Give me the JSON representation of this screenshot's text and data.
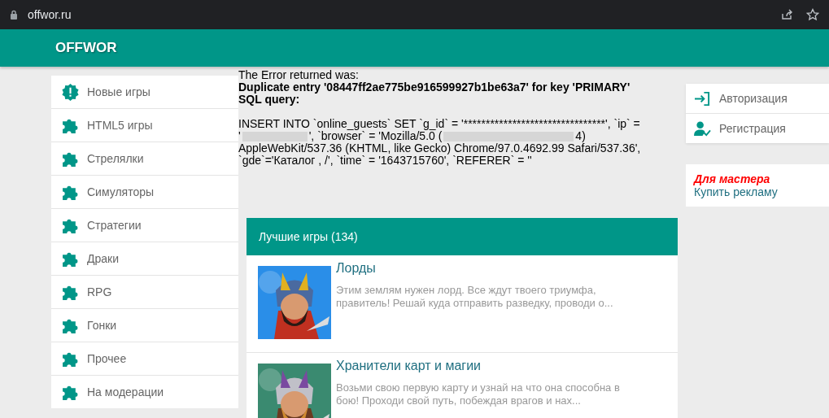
{
  "browser": {
    "url": "offwor.ru"
  },
  "header": {
    "logo": "OFFWOR"
  },
  "sidebar": {
    "items": [
      {
        "label": "Новые игры",
        "kind": "alert"
      },
      {
        "label": "HTML5 игры",
        "kind": "puzzle"
      },
      {
        "label": "Стрелялки",
        "kind": "puzzle"
      },
      {
        "label": "Симуляторы",
        "kind": "puzzle"
      },
      {
        "label": "Стратегии",
        "kind": "puzzle"
      },
      {
        "label": "Драки",
        "kind": "puzzle"
      },
      {
        "label": "RPG",
        "kind": "puzzle"
      },
      {
        "label": "Гонки",
        "kind": "puzzle"
      },
      {
        "label": "Прочее",
        "kind": "puzzle"
      },
      {
        "label": "На модерации",
        "kind": "puzzle"
      }
    ]
  },
  "error": {
    "intro": "The Error returned was:",
    "message": "Duplicate entry '08447ff2ae775be916599927b1be63a7' for key 'PRIMARY'",
    "query_label": "SQL query:",
    "query_lines": [
      [
        {
          "kind": "text",
          "text": "INSERT INTO `online_guests` SET `g_id` = '********************************', `ip` ="
        }
      ],
      [
        {
          "kind": "text",
          "text": "'"
        },
        {
          "kind": "redacted"
        },
        {
          "kind": "text",
          "text": "', `browser` = 'Mozilla/5.0 ("
        },
        {
          "kind": "redacted"
        },
        {
          "kind": "text",
          "text": "4)"
        }
      ],
      [
        {
          "kind": "text",
          "text": "AppleWebKit/537.36 (KHTML, like Gecko) Chrome/97.0.4692.99 Safari/537.36',"
        }
      ],
      [
        {
          "kind": "text",
          "text": "`gde`='Каталог , /', `time` = '1643715760', `REFERER` = ''"
        }
      ]
    ]
  },
  "best_games": {
    "title": "Лучшие игры (134)",
    "games": [
      {
        "title": "Лорды",
        "description": "Этим землям нужен лорд. Все ждут твоего триумфа, правитель! Решай куда отправить разведку, проводи о...",
        "kind": "picture"
      },
      {
        "title": "Хранители карт и магии",
        "description": "Возьми свою первую карту и узнай на что она способна в бою! Проходи свой путь, побеждая врагов и нах...",
        "kind": "picture"
      }
    ]
  },
  "account": {
    "items": [
      {
        "label": "Авторизация",
        "kind": "login"
      },
      {
        "label": "Регистрация",
        "kind": "register"
      }
    ]
  },
  "ad_box": {
    "heading": "Для мастера",
    "link": "Купить рекламу"
  }
}
